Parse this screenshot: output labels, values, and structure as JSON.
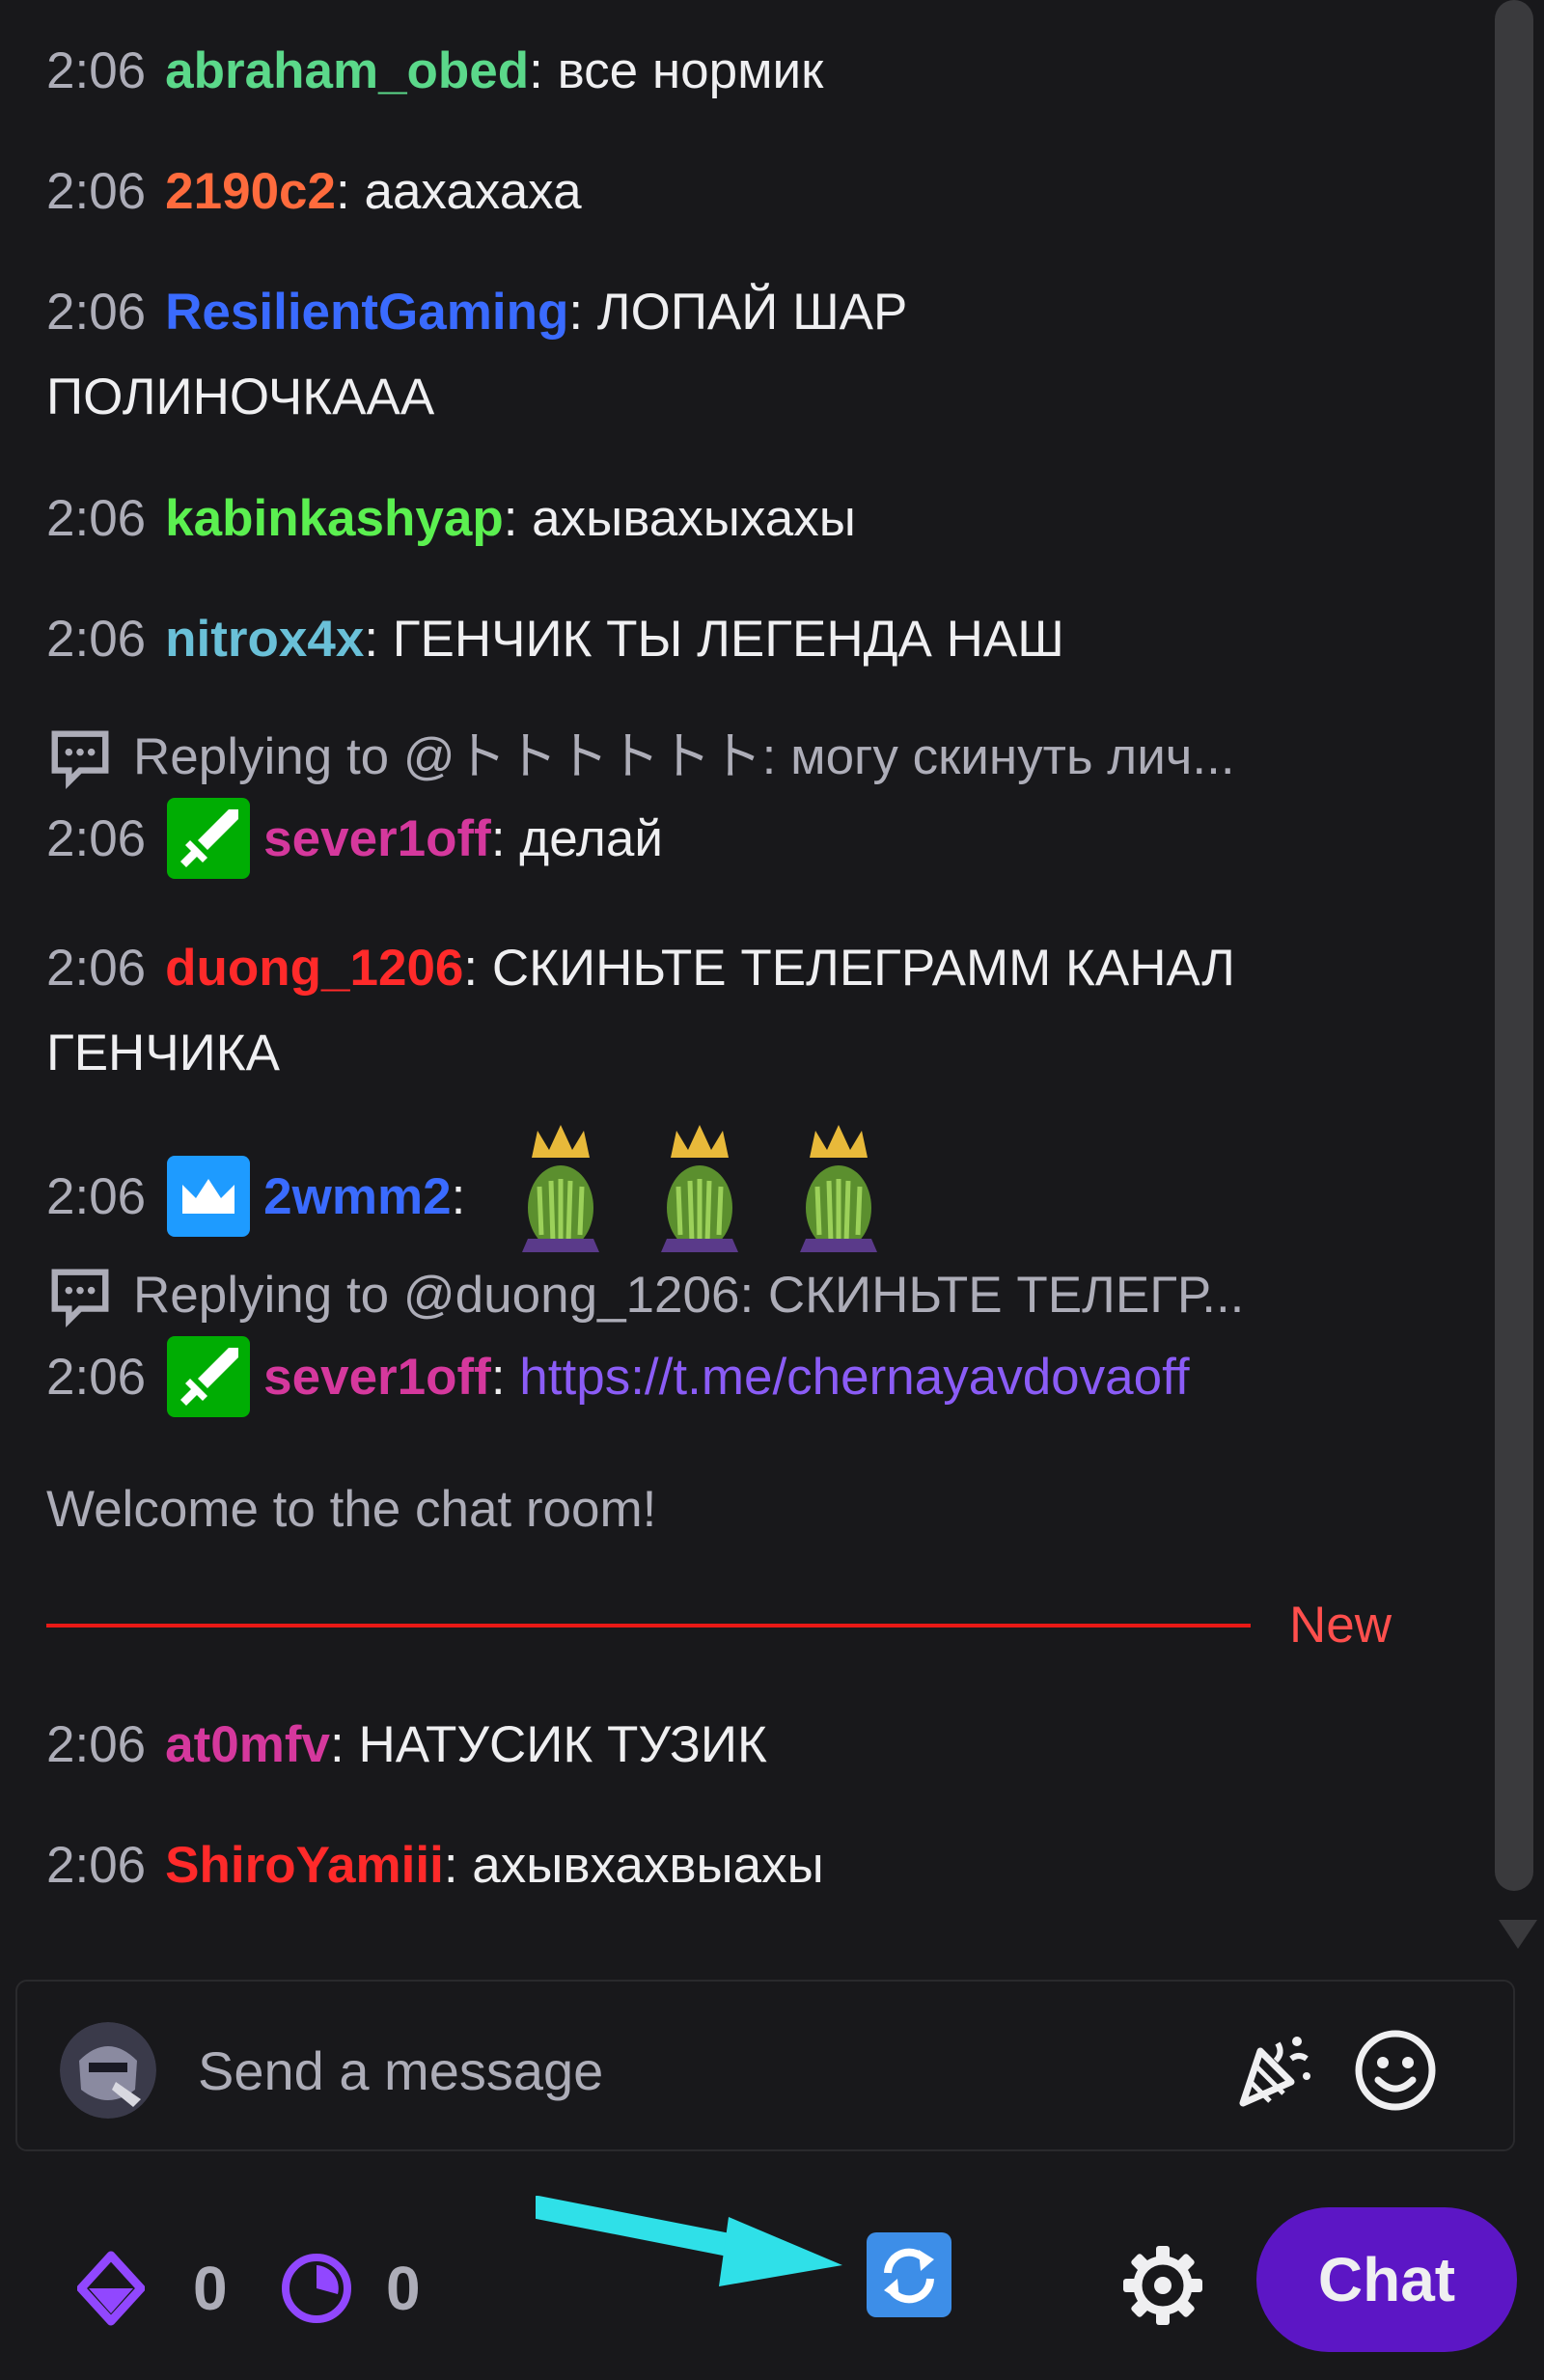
{
  "colors": {
    "background": "#18181b",
    "accent": "#5c16c5",
    "new_divider": "#e91916",
    "link": "#8b5cf6"
  },
  "messages": [
    {
      "time": "2:06",
      "user": "abraham_obed",
      "user_color": "#5bd88a",
      "text": ": все нормик"
    },
    {
      "time": "2:06",
      "user": "2190c2",
      "user_color": "#ff6b3d",
      "text": ": аахахаха"
    },
    {
      "time": "2:06",
      "user": "ResilientGaming",
      "user_color": "#3a6bff",
      "text": ": ЛОПАЙ ШАР",
      "text2": "ПОЛИНОЧКААА"
    },
    {
      "time": "2:06",
      "user": "kabinkashyap",
      "user_color": "#5bf050",
      "text": ": ахывахыхахы"
    },
    {
      "time": "2:06",
      "user": "nitrox4x",
      "user_color": "#6ac0d8",
      "text": ": ГЕНЧИК ТЫ ЛЕГЕНДА НАШ"
    },
    {
      "reply": "Replying to @トトトトトト: могу скинуть лич...",
      "time": "2:06",
      "badge": "sword-badge",
      "user": "sever1off",
      "user_color": "#d5389d",
      "text": ": делай"
    },
    {
      "time": "2:06",
      "user": "duong_1206",
      "user_color": "#ff2a2a",
      "text": ": СКИНЬТЕ ТЕЛЕГРАММ КАНАЛ",
      "text2": "ГЕНЧИКА"
    },
    {
      "time": "2:06",
      "badge": "crown-badge",
      "user": "2wmm2",
      "user_color": "#3a6bff",
      "text": ":",
      "emotes": [
        "crowned-moss-emote",
        "crowned-moss-emote",
        "crowned-moss-emote"
      ]
    },
    {
      "reply": "Replying to @duong_1206: СКИНЬТЕ ТЕЛЕГР...",
      "time": "2:06",
      "badge": "sword-badge",
      "user": "sever1off",
      "user_color": "#d5389d",
      "text": ": ",
      "link": "https://t.me/chernayavdovaoff"
    },
    {
      "time": "2:06",
      "user": "at0mfv",
      "user_color": "#d5389d",
      "text": ": НАТУСИК ТУЗИК"
    },
    {
      "time": "2:06",
      "user": "ShiroYamiii",
      "user_color": "#ff2a2a",
      "text": ": ахывхахвыахы"
    }
  ],
  "welcome": "Welcome to the chat room!",
  "new_label": "New",
  "input": {
    "placeholder": "Send a message"
  },
  "bottom": {
    "points_value": "0",
    "predictions_value": "0",
    "chat_button": "Chat",
    "icons": [
      "points-icon",
      "clock-icon",
      "refresh-icon",
      "gear-icon"
    ]
  }
}
